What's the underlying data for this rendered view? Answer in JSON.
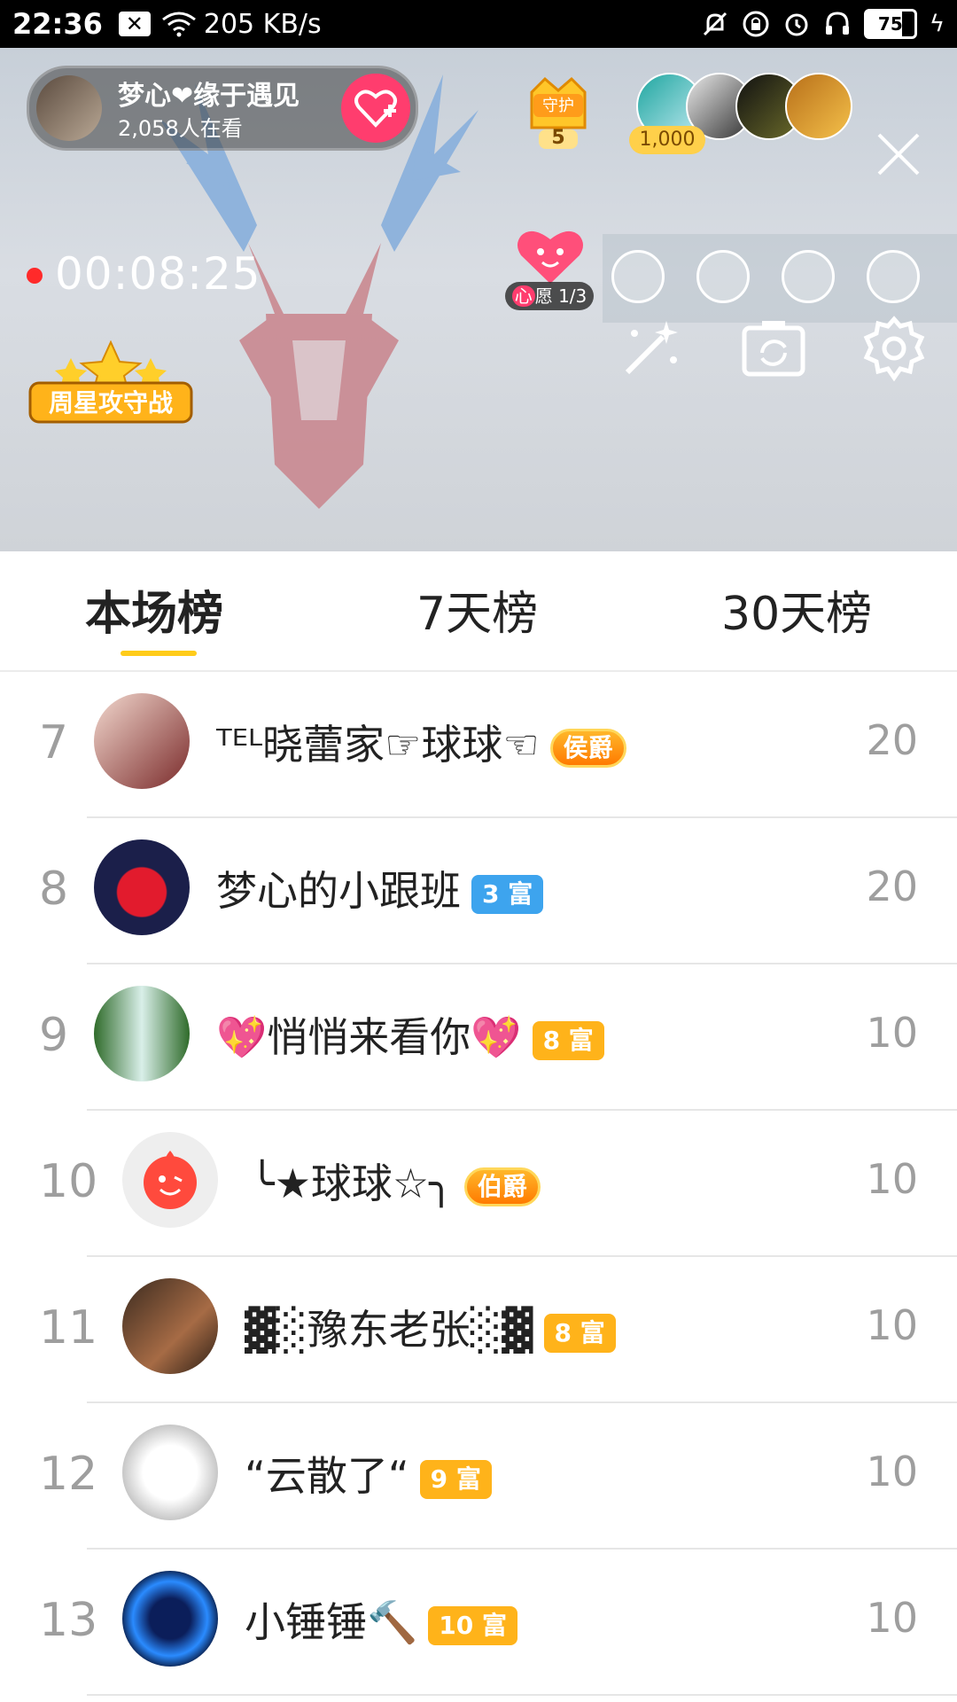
{
  "status_bar": {
    "time": "22:36",
    "speed": "205 KB/s",
    "battery": "75",
    "battery_level": 0.75,
    "icons": [
      "notification-x-icon",
      "wifi-icon",
      "mute-icon",
      "lock-rotate-icon",
      "alarm-icon",
      "headset-icon",
      "battery-icon",
      "charging-icon"
    ]
  },
  "stream": {
    "host_name": "梦心❤缘于遇见",
    "viewers": "2,058人在看",
    "guard_label": "守护",
    "guard_count": "5",
    "coin": "1,000",
    "live_time": "00:08:25",
    "wish_label": "心",
    "wish_text": "愿 1/3",
    "weekly_event": "周星攻守战",
    "colors": {
      "follow": "#ff3d6e",
      "live_dot": "#ff2a2a",
      "tab_underline": "#ffcc1a"
    }
  },
  "tabs": [
    {
      "label": "本场榜",
      "active": true
    },
    {
      "label": "7天榜",
      "active": false
    },
    {
      "label": "30天榜",
      "active": false
    }
  ],
  "ranking": [
    {
      "rank": "7",
      "name": "ᵀᴱᴸ晓蕾家☞球球☜",
      "badge": "侯爵",
      "badge_type": "noble",
      "score": "20"
    },
    {
      "rank": "8",
      "name": "梦心的小跟班",
      "badge": "3 富",
      "badge_type": "blue",
      "score": "20"
    },
    {
      "rank": "9",
      "name": "💖悄悄来看你💖",
      "badge": "8 富",
      "badge_type": "gold",
      "score": "10"
    },
    {
      "rank": "10",
      "name": "╰★球球☆╮",
      "badge": "伯爵",
      "badge_type": "noble",
      "score": "10"
    },
    {
      "rank": "11",
      "name": "▓░豫东老张░▓",
      "badge": "8 富",
      "badge_type": "gold",
      "score": "10"
    },
    {
      "rank": "12",
      "name": "“云散了“",
      "badge": "9 富",
      "badge_type": "gold",
      "score": "10"
    },
    {
      "rank": "13",
      "name": "小锤锤🔨",
      "badge": "10 富",
      "badge_type": "gold",
      "score": "10"
    }
  ]
}
